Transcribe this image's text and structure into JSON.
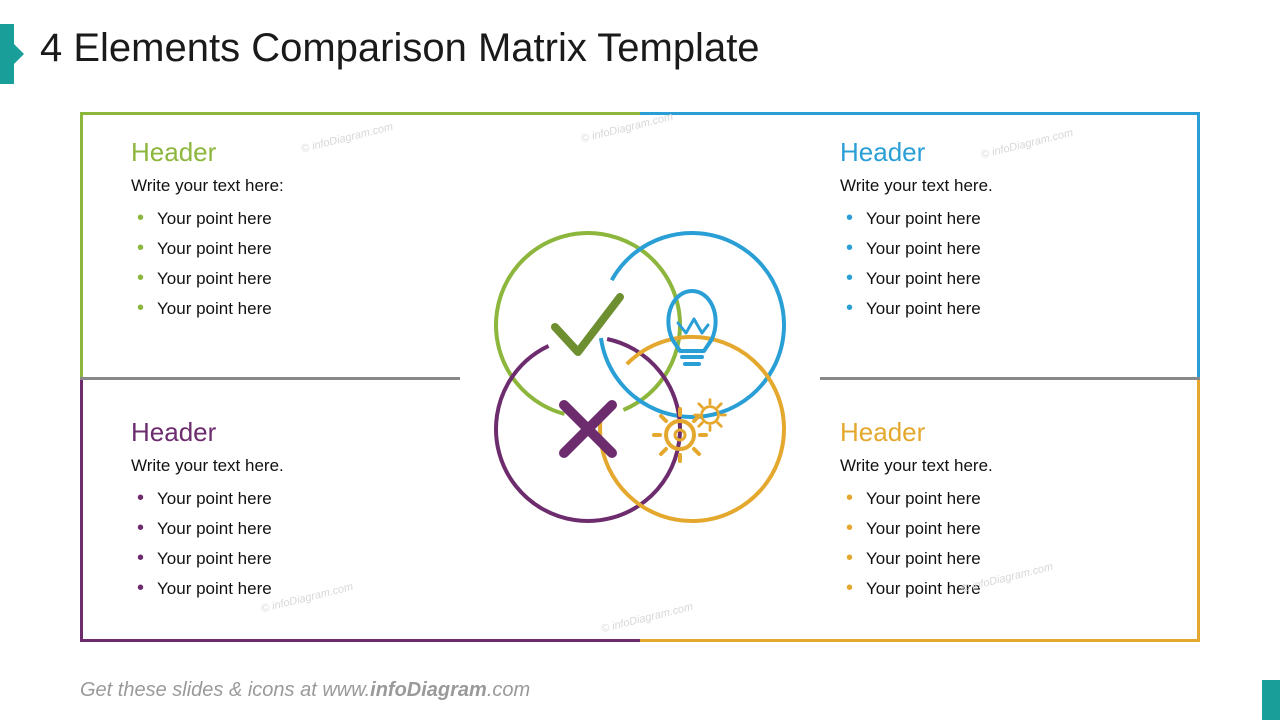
{
  "title": "4 Elements Comparison Matrix Template",
  "footer_prefix": "Get these slides & icons at www.",
  "footer_bold": "infoDiagram",
  "footer_suffix": ".com",
  "watermark": "© infoDiagram.com",
  "colors": {
    "green": "#8cb63c",
    "blue": "#2a9fd6",
    "purple": "#6d2c6d",
    "orange": "#e5a82e"
  },
  "quads": {
    "tl": {
      "header": "Header",
      "lead": "Write your text here:",
      "points": [
        "Your point here",
        "Your point here",
        "Your point here",
        "Your point here"
      ],
      "icon": "check-icon"
    },
    "tr": {
      "header": "Header",
      "lead": "Write your text here.",
      "points": [
        "Your point here",
        "Your point here",
        "Your point here",
        "Your point here"
      ],
      "icon": "lightbulb-icon"
    },
    "bl": {
      "header": "Header",
      "lead": "Write your text here.",
      "points": [
        "Your point here",
        "Your point here",
        "Your point here",
        "Your point here"
      ],
      "icon": "cross-icon"
    },
    "br": {
      "header": "Header",
      "lead": "Write your text here.",
      "points": [
        "Your point here",
        "Your point here",
        "Your point here",
        "Your point here"
      ],
      "icon": "gears-icon"
    }
  }
}
